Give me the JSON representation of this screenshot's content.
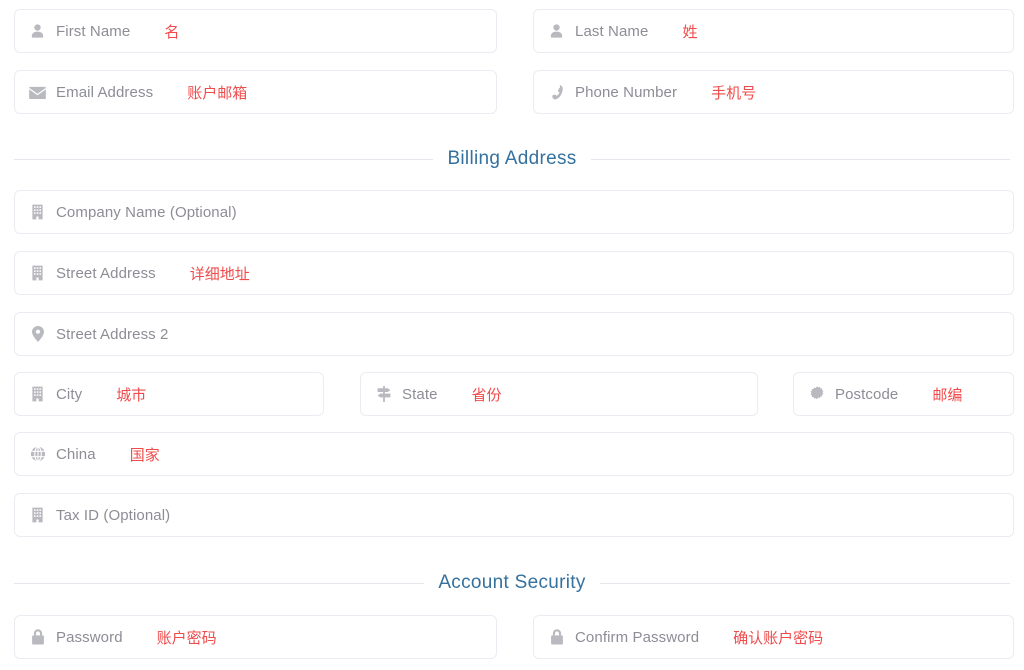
{
  "theme": {
    "page_background": "#ffffff",
    "field_border": "#ebebf2",
    "placeholder_color": "#8d8d96",
    "icon_color": "#b9b9c0",
    "annotation_color": "#f04b4b",
    "section_title_color": "#35719e",
    "divider_line_color": "#e6e6ec"
  },
  "form": {
    "personal": {
      "fields": [
        {
          "name": "first-name",
          "icon": "user-icon",
          "placeholder": "First Name",
          "annotation": "名",
          "value": ""
        },
        {
          "name": "last-name",
          "icon": "user-icon",
          "placeholder": "Last Name",
          "annotation": "姓",
          "value": ""
        },
        {
          "name": "email-address",
          "icon": "envelope-icon",
          "placeholder": "Email Address",
          "annotation": "账户邮箱",
          "value": ""
        },
        {
          "name": "phone-number",
          "icon": "phone-icon",
          "placeholder": "Phone Number",
          "annotation": "手机号",
          "value": ""
        }
      ]
    },
    "sections": [
      {
        "name": "billing-address",
        "title": "Billing Address"
      },
      {
        "name": "account-security",
        "title": "Account Security"
      }
    ],
    "billing": {
      "fields": [
        {
          "name": "company-name",
          "icon": "building-icon",
          "placeholder": "Company Name (Optional)",
          "annotation": "",
          "value": ""
        },
        {
          "name": "street-address",
          "icon": "building-icon",
          "placeholder": "Street Address",
          "annotation": "详细地址",
          "value": ""
        },
        {
          "name": "street-address-2",
          "icon": "map-pin-icon",
          "placeholder": "Street Address 2",
          "annotation": "",
          "value": ""
        },
        {
          "name": "city",
          "icon": "building-icon",
          "placeholder": "City",
          "annotation": "城市",
          "value": ""
        },
        {
          "name": "state",
          "icon": "map-signs-icon",
          "placeholder": "State",
          "annotation": "省份",
          "value": ""
        },
        {
          "name": "postcode",
          "icon": "stamp-icon",
          "placeholder": "Postcode",
          "annotation": "邮编",
          "value": ""
        },
        {
          "name": "country",
          "icon": "globe-icon",
          "placeholder": "China",
          "annotation": "国家",
          "value": "China"
        },
        {
          "name": "tax-id",
          "icon": "building-icon",
          "placeholder": "Tax ID (Optional)",
          "annotation": "",
          "value": ""
        }
      ]
    },
    "security": {
      "fields": [
        {
          "name": "password",
          "icon": "lock-icon",
          "placeholder": "Password",
          "annotation": "账户密码",
          "value": ""
        },
        {
          "name": "confirm-password",
          "icon": "lock-icon",
          "placeholder": "Confirm Password",
          "annotation": "确认账户密码",
          "value": ""
        }
      ]
    }
  }
}
